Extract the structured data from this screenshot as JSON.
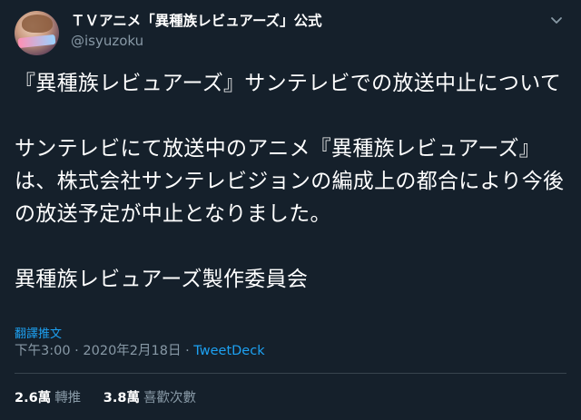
{
  "author": {
    "display_name": "ＴＶアニメ「異種族レビュアーズ」公式",
    "handle": "@isyuzoku",
    "avatar_icon": "anime-avatar-icon"
  },
  "menu_icon": "chevron-down-icon",
  "tweet": {
    "paragraphs": [
      "『異種族レビュアーズ』サンテレビでの放送中止について",
      "サンテレビにて放送中のアニメ『異種族レビュアーズ』は、株式会社サンテレビジョンの編成上の都合により今後の放送予定が中止となりました。",
      "異種族レビュアーズ製作委員会"
    ],
    "translate_label": "翻譯推文",
    "time": "下午3:00",
    "separator": " · ",
    "date": "2020年2月18日",
    "source": "TweetDeck"
  },
  "stats": [
    {
      "value": "2.6萬",
      "label": "轉推"
    },
    {
      "value": "3.8萬",
      "label": "喜歡次數"
    }
  ],
  "colors": {
    "background": "#15202b",
    "accent": "#1da1f2",
    "secondary_text": "#8899a6",
    "divider": "#38444d"
  }
}
